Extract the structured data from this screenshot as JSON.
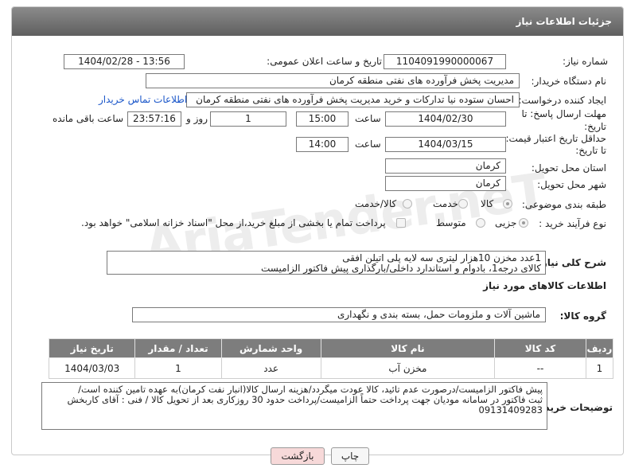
{
  "header": {
    "title": "جزئیات اطلاعات نیاز"
  },
  "fields": {
    "need_number_label": "شماره نیاز:",
    "need_number": "1104091990000067",
    "announce_label": "تاریخ و ساعت اعلان عمومی:",
    "announce_value": "1404/02/28 - 13:56",
    "buyer_org_label": "نام دستگاه خریدار:",
    "buyer_org": "مدیریت پخش فرآورده های نفتی منطقه کرمان",
    "requester_label": "ایجاد کننده درخواست:",
    "requester": "احسان  ستوده نیا  تدارکات و خرید  مدیریت پخش فرآورده های نفتی منطقه کرمان",
    "buyer_contact_link": "اطلاعات تماس خریدار",
    "reply_deadline_label_1": "مهلت ارسال پاسخ: تا",
    "reply_deadline_label_2": "تاریخ:",
    "reply_date": "1404/02/30",
    "time_label": "ساعت",
    "reply_time": "15:00",
    "days_value": "1",
    "days_label": "روز و",
    "remaining_time": "23:57:16",
    "remaining_label": "ساعت باقی مانده",
    "price_validity_label_1": "حداقل تاریخ اعتبار قیمت:",
    "price_validity_label_2": "تا تاریخ:",
    "validity_date": "1404/03/15",
    "validity_time": "14:00",
    "province_label": "استان محل تحویل:",
    "province": "کرمان",
    "city_label": "شهر محل تحویل:",
    "city": "کرمان",
    "category_label": "طبقه بندی موضوعی:",
    "category_options": [
      "کالا",
      "خدمت",
      "کالا/خدمت"
    ],
    "purchase_type_label": "نوع فرآیند خرید :",
    "purchase_type_options": [
      "جزیی",
      "متوسط"
    ],
    "treasury_note": "پرداخت تمام یا بخشی از مبلغ خرید،از محل \"اسناد خزانه اسلامی\" خواهد بود."
  },
  "description": {
    "label": "شرح کلی نیاز:",
    "line1": "1عدد مخزن 10هزار لیتری سه لایه پلی اتیلن افقی",
    "line2": "کالای درجه1، بادوام و استاندارد داخلی/بارگذاری پیش فاکتور الزامیست"
  },
  "goods": {
    "section_title": "اطلاعات کالاهای مورد نیاز",
    "group_label": "گروه کالا:",
    "group_value": "ماشین آلات و ملزومات حمل، بسته بندی و نگهداری",
    "columns": [
      "ردیف",
      "کد کالا",
      "نام کالا",
      "واحد شمارش",
      "تعداد / مقدار",
      "تاریخ نیاز"
    ],
    "rows": [
      {
        "row": "1",
        "code": "--",
        "name": "مخزن آب",
        "unit": "عدد",
        "qty": "1",
        "date": "1404/03/03"
      }
    ]
  },
  "buyer_notes": {
    "label": "توضیحات خریدار:",
    "line1": "پیش فاکتور الزامیست/درصورت عدم تائید، کالا عودت میگردد/هزینه ارسال کالا(انبار نفت کرمان)به عهده تامین کننده است/",
    "line2": "ثبت فاکتور در سامانه مودیان جهت پرداخت حتماً الزامیست/پرداخت حدود 30 روزکاری بعد از تحویل کالا / فنی : آقای کاربخش",
    "line3": "09131409283"
  },
  "buttons": {
    "print": "چاپ",
    "back": "بازگشت"
  },
  "watermark": "AriaTender.neT",
  "colors": {
    "header_bg": "#6f6f6f",
    "table_header_bg": "#7d7d7d",
    "back_button_bg": "#f7d9d9",
    "link": "#1a56c9"
  }
}
